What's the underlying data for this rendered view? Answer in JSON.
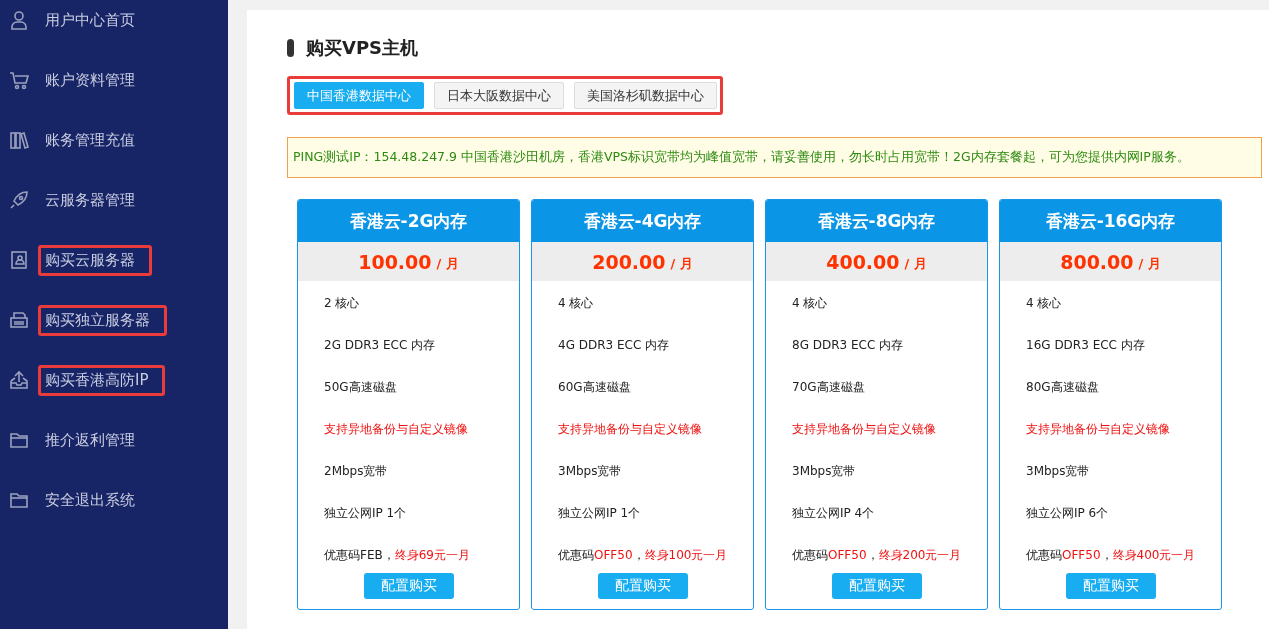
{
  "sidebar": {
    "items": [
      {
        "label": "用户中心首页",
        "annotated": false
      },
      {
        "label": "账户资料管理",
        "annotated": false
      },
      {
        "label": "账务管理充值",
        "annotated": false
      },
      {
        "label": "云服务器管理",
        "annotated": false
      },
      {
        "label": "购买云服务器",
        "annotated": true
      },
      {
        "label": "购买独立服务器",
        "annotated": true
      },
      {
        "label": "购买香港高防IP",
        "annotated": true
      },
      {
        "label": "推介返利管理",
        "annotated": false
      },
      {
        "label": "安全退出系统",
        "annotated": false
      }
    ]
  },
  "page_title": "购买VPS主机",
  "tabs_annotated": true,
  "tabs": [
    {
      "label": "中国香港数据中心",
      "selected": true
    },
    {
      "label": "日本大阪数据中心",
      "selected": false
    },
    {
      "label": "美国洛杉矶数据中心",
      "selected": false
    }
  ],
  "notice": "PING测试IP：154.48.247.9 中国香港沙田机房，香港VPS标识宽带均为峰值宽带，请妥善使用，勿长时占用宽带！2G内存套餐起，可为您提供内网IP服务。",
  "plans": [
    {
      "name": "香港云-2G内存",
      "price": "100.00",
      "unit": "/ 月",
      "features": [
        [
          {
            "text": "2 核心",
            "red": false
          }
        ],
        [
          {
            "text": "2G DDR3 ECC 内存",
            "red": false
          }
        ],
        [
          {
            "text": "50G高速磁盘",
            "red": false
          }
        ],
        [
          {
            "text": "支持异地备份与自定义镜像",
            "red": true
          }
        ],
        [
          {
            "text": "2Mbps宽带",
            "red": false
          }
        ],
        [
          {
            "text": "独立公网IP 1个",
            "red": false
          }
        ],
        [
          {
            "text": "优惠码FEB，",
            "red": false
          },
          {
            "text": "终身69元一月",
            "red": true
          }
        ]
      ],
      "button": "配置购买"
    },
    {
      "name": "香港云-4G内存",
      "price": "200.00",
      "unit": "/ 月",
      "features": [
        [
          {
            "text": "4 核心",
            "red": false
          }
        ],
        [
          {
            "text": "4G DDR3 ECC 内存",
            "red": false
          }
        ],
        [
          {
            "text": "60G高速磁盘",
            "red": false
          }
        ],
        [
          {
            "text": "支持异地备份与自定义镜像",
            "red": true
          }
        ],
        [
          {
            "text": "3Mbps宽带",
            "red": false
          }
        ],
        [
          {
            "text": "独立公网IP 1个",
            "red": false
          }
        ],
        [
          {
            "text": "优惠码",
            "red": false
          },
          {
            "text": "OFF50",
            "red": true
          },
          {
            "text": "，",
            "red": false
          },
          {
            "text": "终身100元一月",
            "red": true
          }
        ]
      ],
      "button": "配置购买"
    },
    {
      "name": "香港云-8G内存",
      "price": "400.00",
      "unit": "/ 月",
      "features": [
        [
          {
            "text": "4 核心",
            "red": false
          }
        ],
        [
          {
            "text": "8G DDR3 ECC 内存",
            "red": false
          }
        ],
        [
          {
            "text": "70G高速磁盘",
            "red": false
          }
        ],
        [
          {
            "text": "支持异地备份与自定义镜像",
            "red": true
          }
        ],
        [
          {
            "text": "3Mbps宽带",
            "red": false
          }
        ],
        [
          {
            "text": "独立公网IP 4个",
            "red": false
          }
        ],
        [
          {
            "text": "优惠码",
            "red": false
          },
          {
            "text": "OFF50",
            "red": true
          },
          {
            "text": "，",
            "red": false
          },
          {
            "text": "终身200元一月",
            "red": true
          }
        ]
      ],
      "button": "配置购买"
    },
    {
      "name": "香港云-16G内存",
      "price": "800.00",
      "unit": "/ 月",
      "features": [
        [
          {
            "text": "4 核心",
            "red": false
          }
        ],
        [
          {
            "text": "16G DDR3 ECC 内存",
            "red": false
          }
        ],
        [
          {
            "text": "80G高速磁盘",
            "red": false
          }
        ],
        [
          {
            "text": "支持异地备份与自定义镜像",
            "red": true
          }
        ],
        [
          {
            "text": "3Mbps宽带",
            "red": false
          }
        ],
        [
          {
            "text": "独立公网IP 6个",
            "red": false
          }
        ],
        [
          {
            "text": "优惠码",
            "red": false
          },
          {
            "text": "OFF50",
            "red": true
          },
          {
            "text": "，",
            "red": false
          },
          {
            "text": "终身400元一月",
            "red": true
          }
        ]
      ],
      "button": "配置购买"
    }
  ]
}
